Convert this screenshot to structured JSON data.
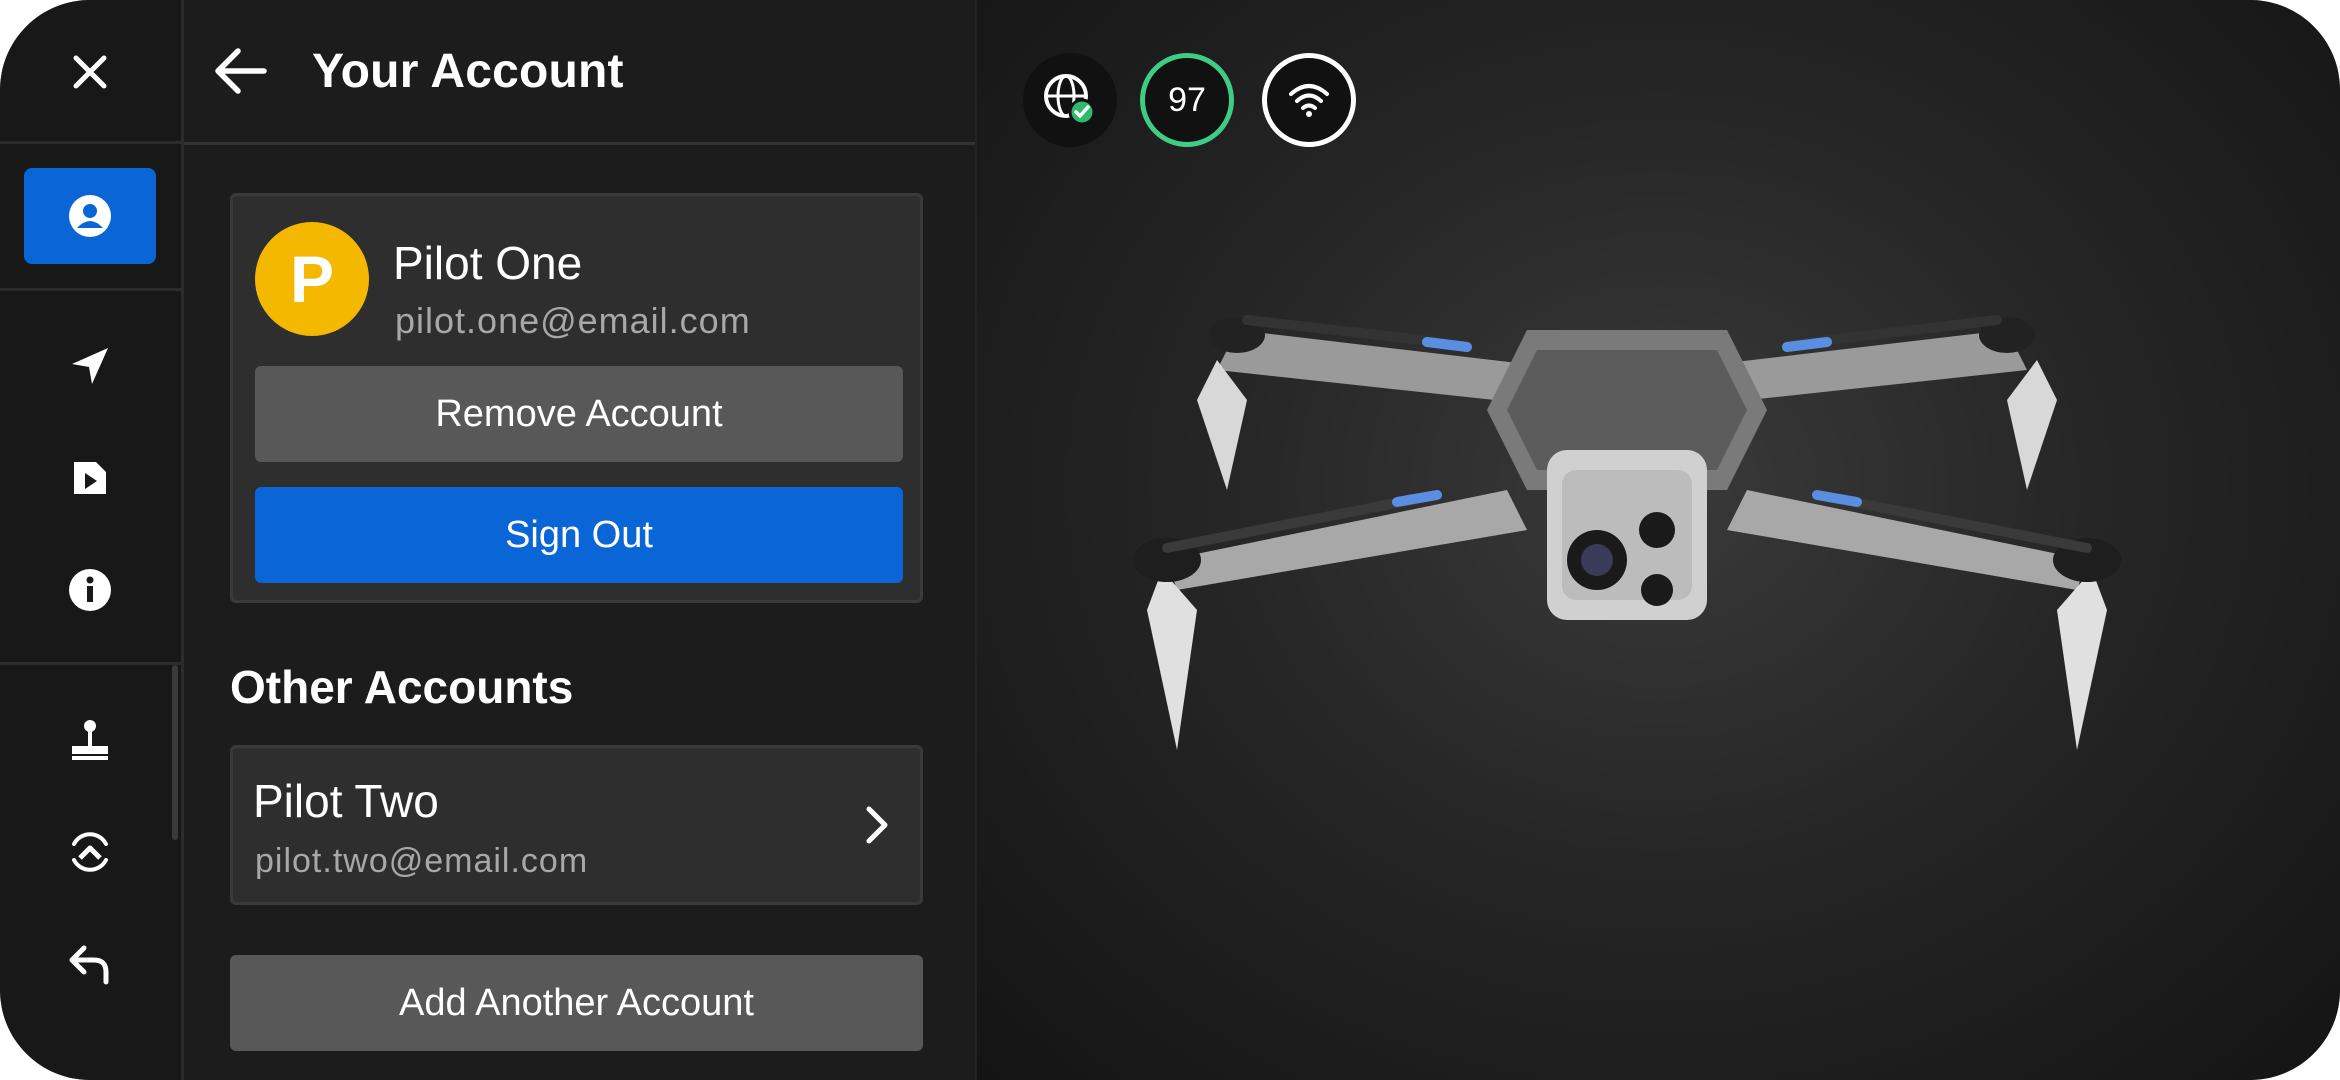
{
  "panel": {
    "title": "Your Account"
  },
  "current_account": {
    "avatar_letter": "P",
    "avatar_color": "#F5B800",
    "name": "Pilot One",
    "email": "pilot.one@email.com",
    "remove_label": "Remove Account",
    "signout_label": "Sign Out"
  },
  "other_accounts": {
    "title": "Other Accounts",
    "items": [
      {
        "name": "Pilot Two",
        "email": "pilot.two@email.com"
      }
    ],
    "add_label": "Add Another Account"
  },
  "status": {
    "battery_percent": "97",
    "battery_color": "#3FCC84",
    "gps_icon": "globe-check-icon",
    "signal_icon": "wifi-icon"
  },
  "rail": {
    "items": [
      {
        "icon": "close-icon"
      },
      {
        "icon": "account-icon",
        "active": true
      },
      {
        "icon": "navigation-icon"
      },
      {
        "icon": "media-files-icon"
      },
      {
        "icon": "info-icon"
      },
      {
        "icon": "joystick-icon"
      },
      {
        "icon": "drone-sync-icon"
      },
      {
        "icon": "return-icon"
      }
    ]
  },
  "colors": {
    "accent": "#0A66D6",
    "panel_bg": "#1C1C1C",
    "card_bg": "#2E2E2E"
  }
}
